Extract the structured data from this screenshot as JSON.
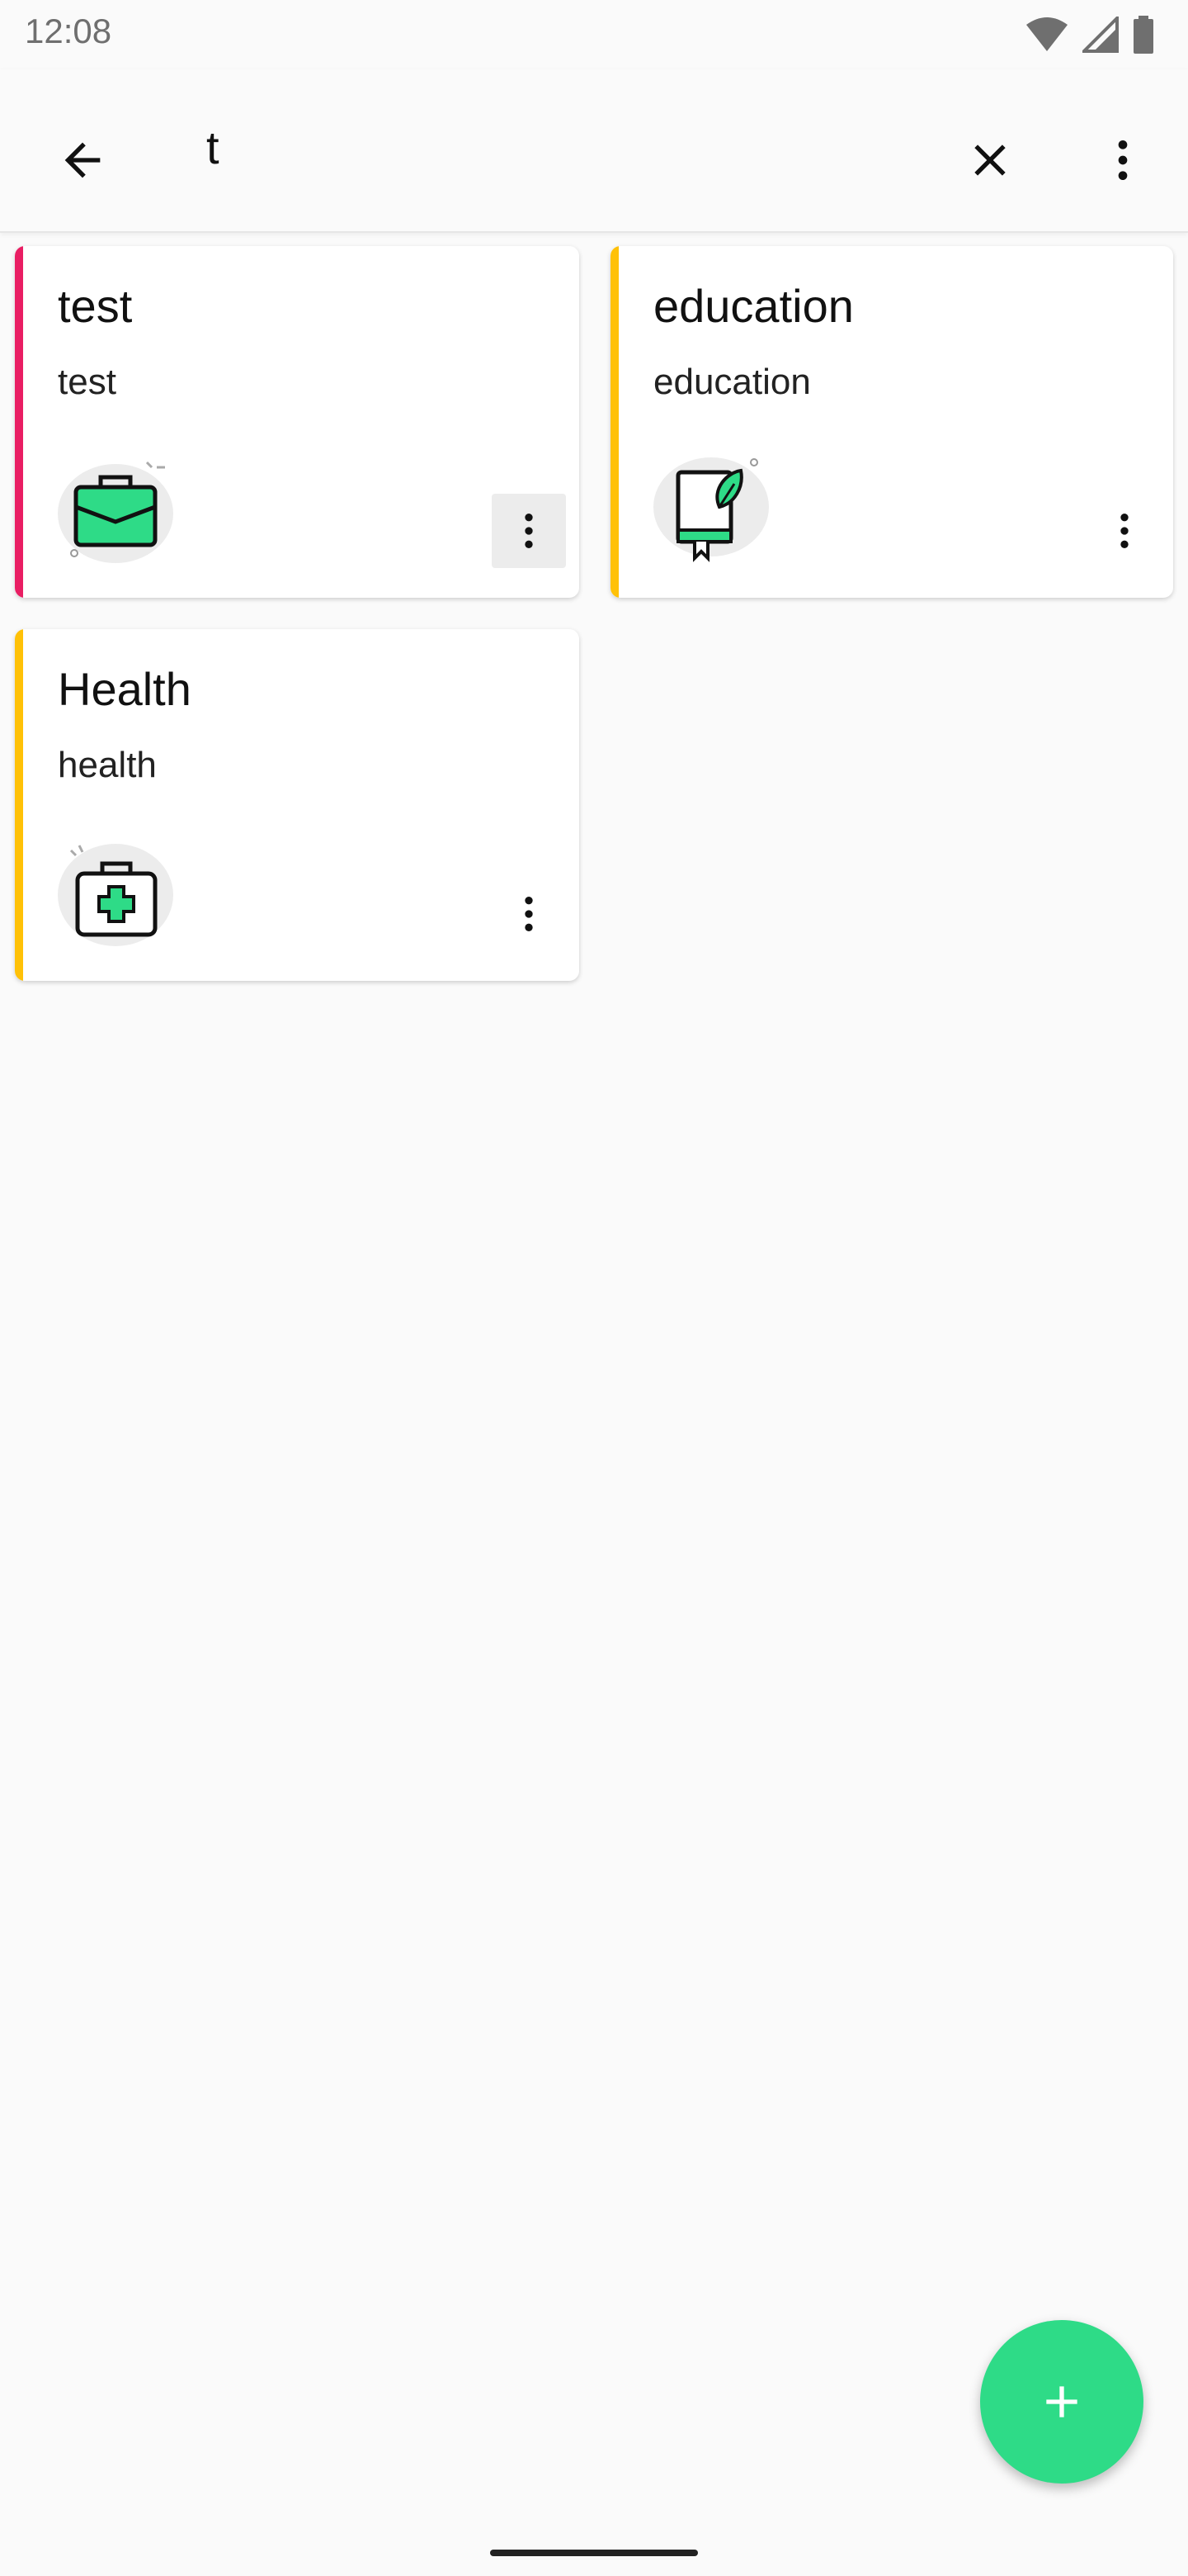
{
  "status_bar": {
    "time": "12:08"
  },
  "search": {
    "query": "t"
  },
  "cards": [
    {
      "title": "test",
      "subtitle": "test",
      "accent": "#e91e63",
      "icon": "briefcase-icon"
    },
    {
      "title": "education",
      "subtitle": "education",
      "accent": "#ffc107",
      "icon": "book-leaf-icon"
    },
    {
      "title": "Health",
      "subtitle": "health",
      "accent": "#ffc107",
      "icon": "medical-kit-icon"
    }
  ],
  "colors": {
    "accent_green": "#2edb87"
  }
}
